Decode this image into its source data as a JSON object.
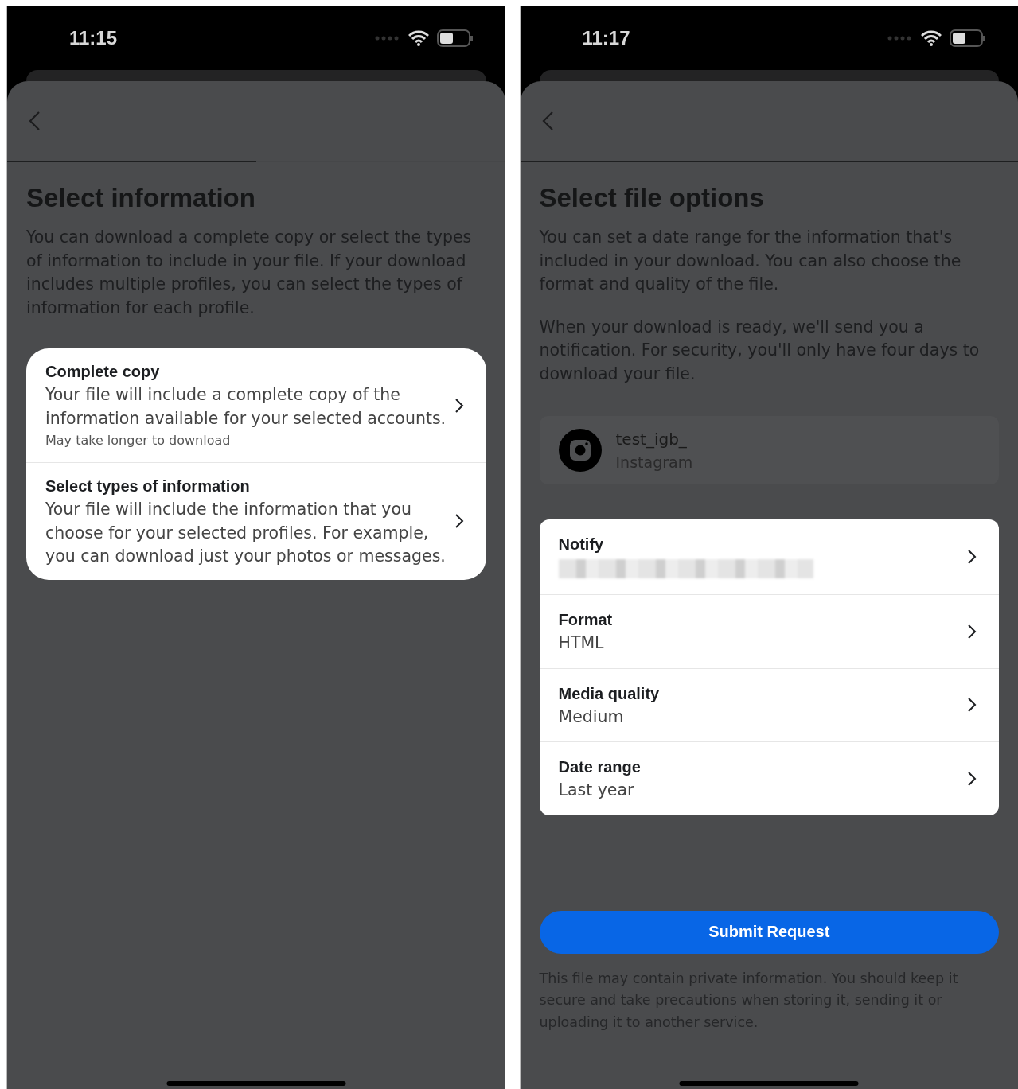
{
  "screens": [
    {
      "status_bar": {
        "time": "11:15"
      },
      "progress": {
        "level": 0.5
      },
      "title": "Select information",
      "paragraphs": [
        "You can download a complete copy or select the types of information to include in your file. If your download includes multiple profiles, you can select the types of information for each profile."
      ],
      "choices": [
        {
          "title": "Complete copy",
          "description": "Your file will include a complete copy of the information available for your selected accounts.",
          "note": "May take longer to download"
        },
        {
          "title": "Select types of information",
          "description": "Your file will include the information that you choose for your selected profiles. For example, you can download just your photos or messages."
        }
      ]
    },
    {
      "status_bar": {
        "time": "11:17"
      },
      "progress": {
        "level": 1
      },
      "title": "Select file options",
      "paragraphs": [
        "You can set a date range for the information that's included in your download. You can also choose the format and quality of the file.",
        "When your download is ready, we'll send you a notification. For security, you'll only have four days to download your file."
      ],
      "account": {
        "name": "test_igb_",
        "service": "Instagram"
      },
      "settings": [
        {
          "label": "Notify",
          "value_hidden": true
        },
        {
          "label": "Format",
          "value": "HTML",
          "value_hidden": false
        },
        {
          "label": "Media quality",
          "value": "Medium",
          "value_hidden": false
        },
        {
          "label": "Date range",
          "value": "Last year",
          "value_hidden": false
        }
      ],
      "submit_button": "Submit Request",
      "disclaimer": "This file may contain private information. You should keep it secure and take precautions when storing it, sending it or uploading it to another service."
    }
  ]
}
